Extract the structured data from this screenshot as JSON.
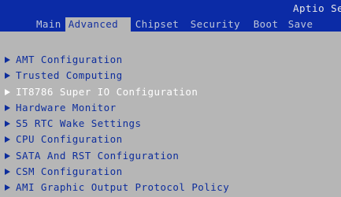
{
  "header": {
    "brand": "Aptio Se",
    "tabs": [
      {
        "label": "Main",
        "active": false
      },
      {
        "label": "Advanced",
        "active": true
      },
      {
        "label": "Chipset",
        "active": false
      },
      {
        "label": "Security",
        "active": false
      },
      {
        "label": "Boot",
        "active": false
      },
      {
        "label": "Save",
        "active": false
      }
    ]
  },
  "menu": {
    "items": [
      {
        "label": "AMT Configuration",
        "icon": "triangle-right-icon",
        "selected": false
      },
      {
        "label": "Trusted Computing",
        "icon": "triangle-right-icon",
        "selected": false
      },
      {
        "label": "IT8786 Super IO Configuration",
        "icon": "triangle-right-icon",
        "selected": true
      },
      {
        "label": "Hardware Monitor",
        "icon": "triangle-right-icon",
        "selected": false
      },
      {
        "label": "S5 RTC Wake Settings",
        "icon": "triangle-right-icon",
        "selected": false
      },
      {
        "label": "CPU Configuration",
        "icon": "triangle-right-icon",
        "selected": false
      },
      {
        "label": "SATA And RST Configuration",
        "icon": "triangle-right-icon",
        "selected": false
      },
      {
        "label": "CSM Configuration",
        "icon": "triangle-right-icon",
        "selected": false
      },
      {
        "label": "AMI Graphic Output Protocol Policy",
        "icon": "triangle-right-icon",
        "selected": false
      }
    ]
  },
  "colors": {
    "header_bg": "#0b2ba6",
    "body_bg": "#b6b6b6",
    "item_text": "#0d2d9c",
    "selected_text": "#ffffff"
  }
}
